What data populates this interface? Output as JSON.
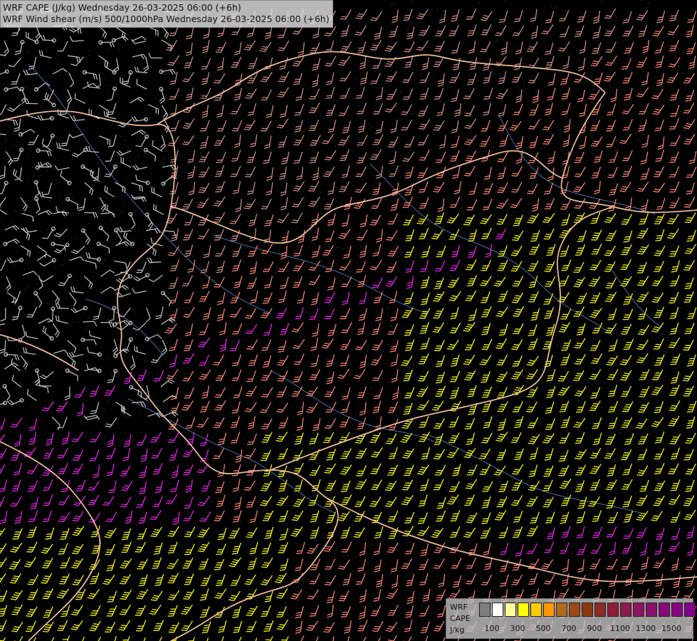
{
  "title": {
    "line1": "WRF CAPE (J/kg) Wednesday 26-03-2025 06:00 (+6h)",
    "line2": "WRF Wind shear (m/s) 500/1000hPa Wednesday 26-03-2025 06:00 (+6h)"
  },
  "legend": {
    "label1": "WRF",
    "label2": "CAPE",
    "unit": "J/kg",
    "ticks": [
      "100",
      "300",
      "500",
      "700",
      "900",
      "1100",
      "1300",
      "1500"
    ],
    "swatches": [
      "#7f7f7f",
      "#ffffff",
      "#ffff99",
      "#ffff00",
      "#ffcc00",
      "#ff9900",
      "#b06a1c",
      "#9a4a14",
      "#8a3a10",
      "#8e2a2a",
      "#8e1e3c",
      "#8c1a4e",
      "#8c1460",
      "#8a0f6c",
      "#880a78",
      "#860680",
      "#84008a"
    ]
  },
  "colors": {
    "background": "#000000",
    "barb_low": "#b9b9b9",
    "barb_mid": "#c98a80",
    "barb_salmon": "#f08070",
    "barb_magenta": "#e020e0",
    "barb_yellow": "#f0f010",
    "border": "#e8b89a",
    "river": "#4a6ea8"
  }
}
